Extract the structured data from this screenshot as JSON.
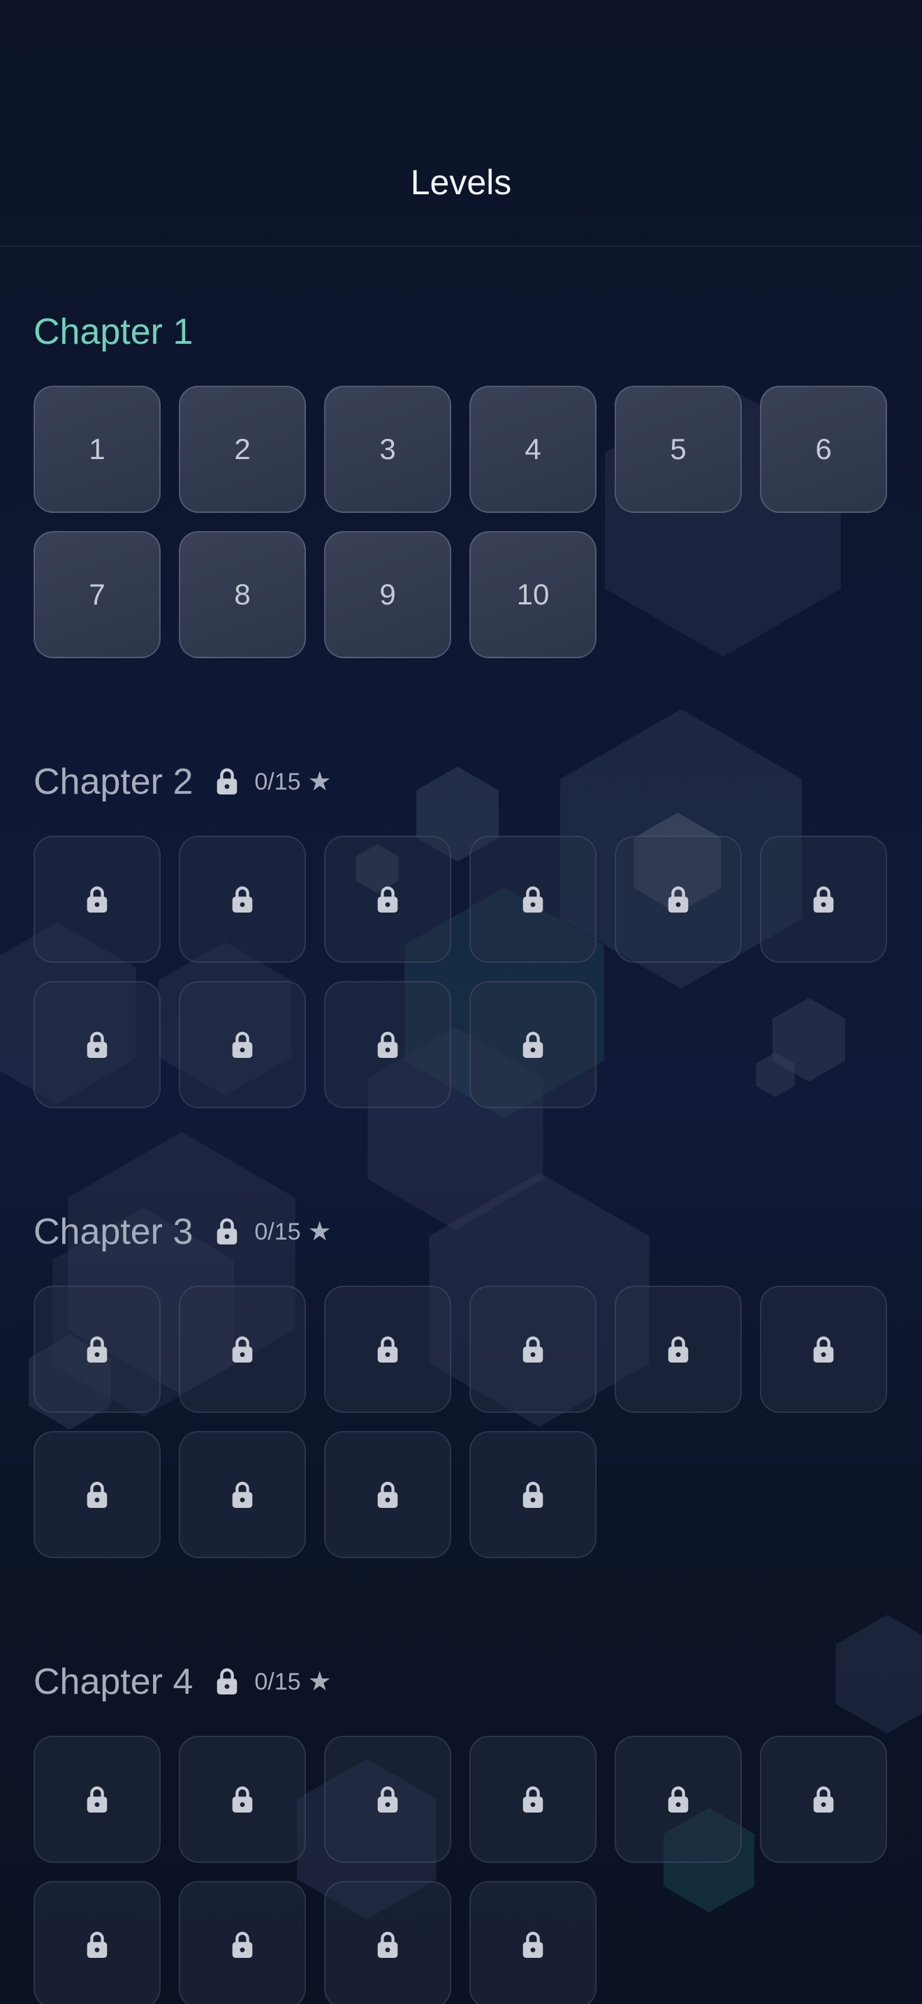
{
  "header": {
    "title": "Levels"
  },
  "icons": {
    "lock": "lock-icon",
    "star": "star-icon"
  },
  "colors": {
    "background": "#0d1428",
    "accent": "#6fd2bb",
    "muted_text": "#a6adbb"
  },
  "chapters": [
    {
      "title": "Chapter 1",
      "locked": false,
      "stars": "",
      "levels": [
        "1",
        "2",
        "3",
        "4",
        "5",
        "6",
        "7",
        "8",
        "9",
        "10"
      ]
    },
    {
      "title": "Chapter 2",
      "locked": true,
      "stars": "0/15",
      "levels": [
        "",
        "",
        "",
        "",
        "",
        "",
        "",
        "",
        "",
        ""
      ]
    },
    {
      "title": "Chapter 3",
      "locked": true,
      "stars": "0/15",
      "levels": [
        "",
        "",
        "",
        "",
        "",
        "",
        "",
        "",
        "",
        ""
      ]
    },
    {
      "title": "Chapter 4",
      "locked": true,
      "stars": "0/15",
      "levels": [
        "",
        "",
        "",
        "",
        "",
        "",
        "",
        "",
        "",
        ""
      ]
    }
  ]
}
